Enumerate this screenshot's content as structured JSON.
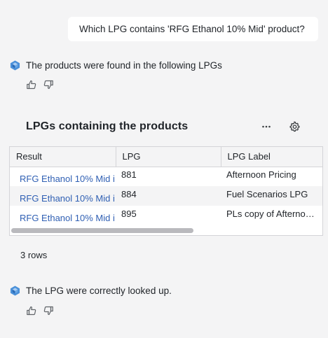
{
  "user_message": "Which LPG contains 'RFG Ethanol 10% Mid' product?",
  "bot_messages": [
    "The products were found in the following LPGs",
    "The LPG were correctly looked up."
  ],
  "card": {
    "title": "LPGs containing the products",
    "more_icon": "more-horizontal-icon",
    "settings_icon": "gear-icon"
  },
  "table": {
    "headers": [
      "Result",
      "LPG",
      "LPG Label"
    ],
    "rows": [
      {
        "result": "RFG Ethanol 10% Mid i",
        "lpg": "881",
        "label": "Afternoon Pricing"
      },
      {
        "result": "RFG Ethanol 10% Mid i",
        "lpg": "884",
        "label": "Fuel Scenarios LPG"
      },
      {
        "result": "RFG Ethanol 10% Mid i",
        "lpg": "895",
        "label": "PLs copy of Afterno…"
      }
    ],
    "row_count": "3 rows"
  },
  "colors": {
    "background": "#f4f4f5",
    "link": "#2f5fb3",
    "bot_icon": "#4a90d9"
  }
}
